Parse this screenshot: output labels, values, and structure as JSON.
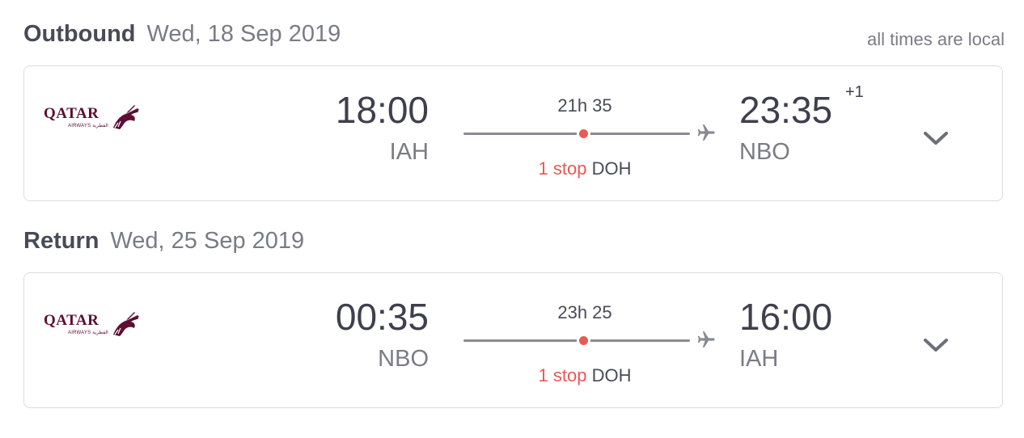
{
  "times_note": "all times are local",
  "legs": [
    {
      "label": "Outbound",
      "date": "Wed, 18 Sep 2019",
      "airline": {
        "logo_text": "QATAR",
        "logo_sub": "AIRWAYS القطرية",
        "logo_icon": "oryx-icon"
      },
      "departure_time": "18:00",
      "departure_code": "IAH",
      "arrival_time": "23:35",
      "arrival_day_offset": "+1",
      "arrival_code": "NBO",
      "duration": "21h 35",
      "stops_label": "1 stop",
      "stop_airport": "DOH"
    },
    {
      "label": "Return",
      "date": "Wed, 25 Sep 2019",
      "airline": {
        "logo_text": "QATAR",
        "logo_sub": "AIRWAYS القطرية",
        "logo_icon": "oryx-icon"
      },
      "departure_time": "00:35",
      "departure_code": "NBO",
      "arrival_time": "16:00",
      "arrival_day_offset": "",
      "arrival_code": "IAH",
      "duration": "23h 25",
      "stops_label": "1 stop",
      "stop_airport": "DOH"
    }
  ],
  "colors": {
    "stop_accent": "#e85a54",
    "brand_maroon": "#5c0f33",
    "route_line": "#8a8a95"
  },
  "icons": {
    "plane": "plane-icon",
    "expand": "chevron-down-icon"
  }
}
